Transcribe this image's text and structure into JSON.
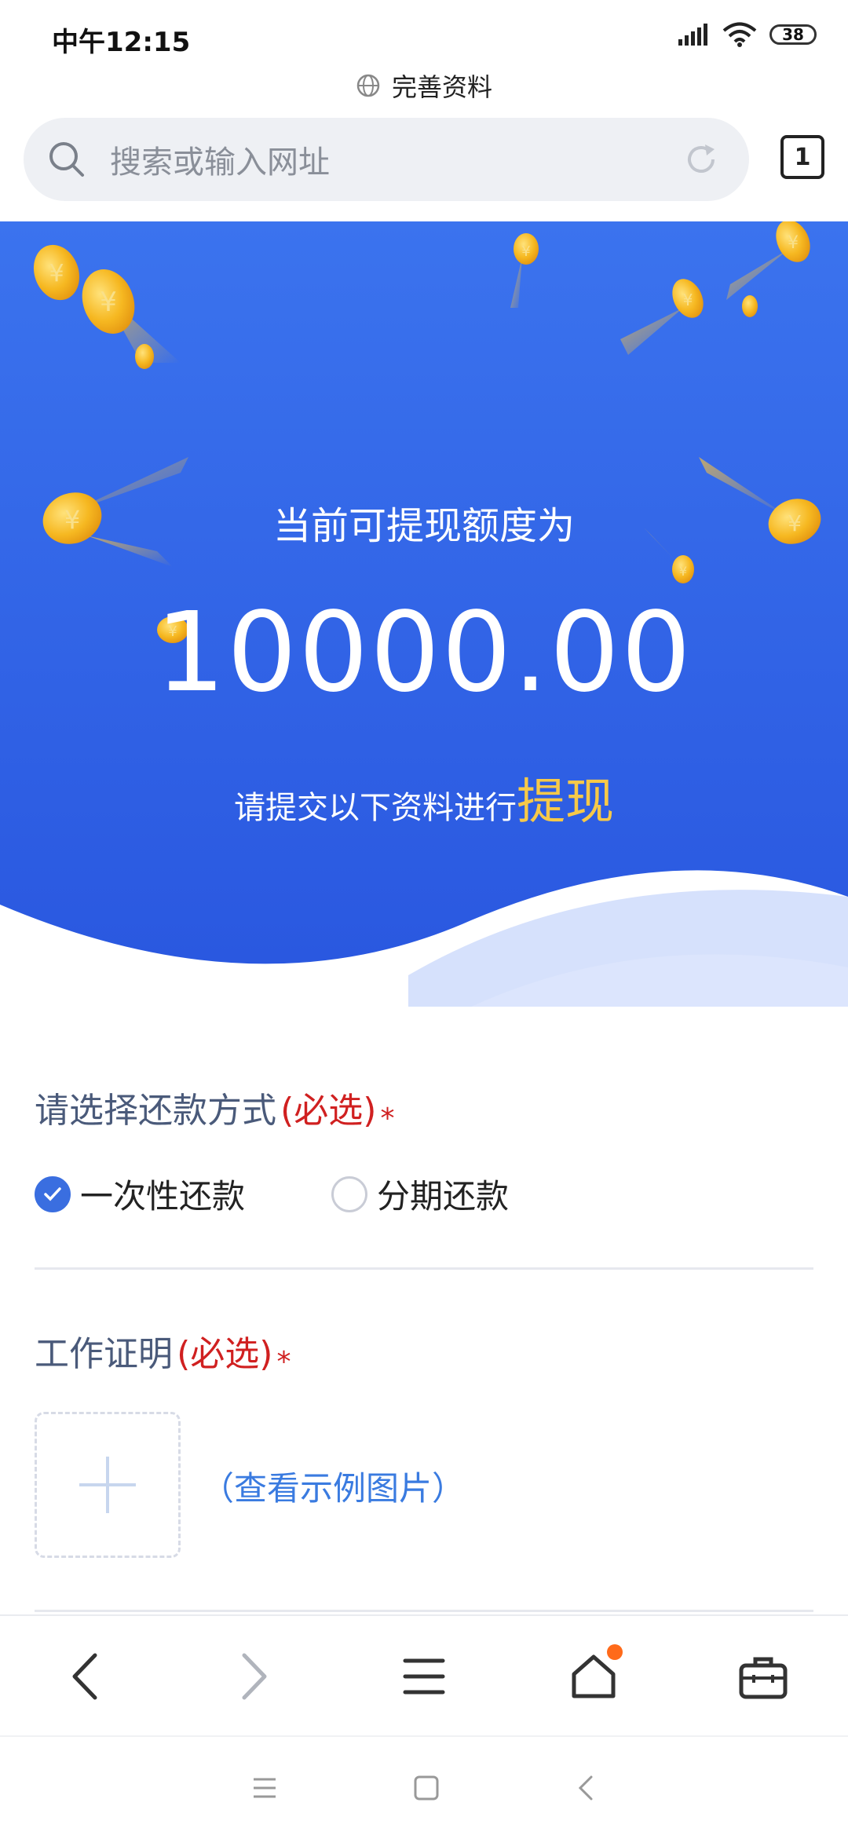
{
  "status_bar": {
    "time": "中午12:15",
    "battery": "38"
  },
  "browser": {
    "page_title": "完善资料",
    "search_placeholder": "搜索或输入网址",
    "tab_count": "1"
  },
  "banner": {
    "caption": "当前可提现额度为",
    "amount": "10000.00",
    "note": "请提交以下资料进行",
    "note_highlight": "提现"
  },
  "form": {
    "repayment": {
      "title": "请选择还款方式",
      "required_label": "(必选)",
      "star": "*",
      "options": [
        {
          "label": "一次性还款",
          "checked": true
        },
        {
          "label": "分期还款",
          "checked": false
        }
      ]
    },
    "work_proof": {
      "title": "工作证明",
      "required_label": "(必选)",
      "star": "*",
      "example_link": "（查看示例图片）"
    }
  },
  "colors": {
    "banner_top": "#3b73ee",
    "banner_bottom": "#2a58e0",
    "accent": "#3a6ee0",
    "highlight": "#f7c948"
  }
}
